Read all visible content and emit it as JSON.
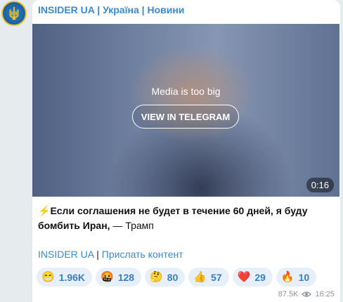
{
  "channel": {
    "name": "INSIDER UA | Україна | Новини"
  },
  "media": {
    "notice": "Media is too big",
    "button_label": "VIEW IN TELEGRAM",
    "duration": "0:16"
  },
  "message": {
    "lightning": "⚡",
    "bold_text": "Если соглашения не будет в течение 60 дней, я буду бомбить Иран,",
    "tail_text": " — Трамп"
  },
  "footer_links": {
    "channel_link": "INSIDER UA",
    "separator": " | ",
    "submit_link": "Прислать контент"
  },
  "reactions": [
    {
      "emoji": "😁",
      "count": "1.96K"
    },
    {
      "emoji": "🤬",
      "count": "128"
    },
    {
      "emoji": "🤔",
      "count": "80"
    },
    {
      "emoji": "👍",
      "count": "57"
    },
    {
      "emoji": "❤️",
      "count": "29"
    },
    {
      "emoji": "🔥",
      "count": "10"
    }
  ],
  "meta": {
    "views": "87.5K",
    "time": "16:25"
  },
  "colors": {
    "accent": "#3a8ad0",
    "reaction_bg": "#e7f0f8"
  }
}
